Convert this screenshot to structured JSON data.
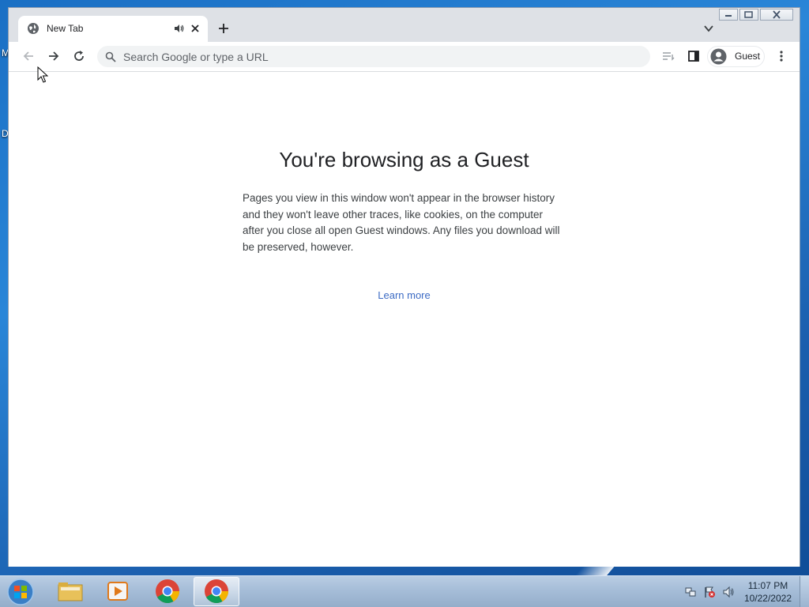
{
  "desktop": {
    "edge_text_1": "M",
    "edge_text_2": "D"
  },
  "tab": {
    "title": "New Tab"
  },
  "omnibox": {
    "placeholder": "Search Google or type a URL"
  },
  "profile": {
    "label": "Guest"
  },
  "content": {
    "heading": "You're browsing as a Guest",
    "description": "Pages you view in this window won't appear in the browser history and they won't leave other traces, like cookies, on the computer after you close all open Guest windows. Any files you download will be preserved, however.",
    "learn_more": "Learn more"
  },
  "taskbar": {
    "time": "11:07 PM",
    "date": "10/22/2022"
  },
  "icons": {
    "tab_favicon": "globe-icon",
    "tab_audio": "speaker-icon",
    "tab_close": "close-icon",
    "new_tab": "plus-icon",
    "tab_search": "chevron-down-icon",
    "back": "arrow-left-icon",
    "forward": "arrow-right-icon",
    "reload": "reload-icon",
    "search": "search-icon",
    "reading_list": "reading-list-icon",
    "side_panel": "side-panel-icon",
    "avatar": "person-icon",
    "menu": "kebab-menu-icon"
  },
  "colors": {
    "link": "#3c6bc4",
    "tabstrip_bg": "#dee1e6",
    "omnibox_bg": "#f1f3f4",
    "heading": "#202124"
  }
}
